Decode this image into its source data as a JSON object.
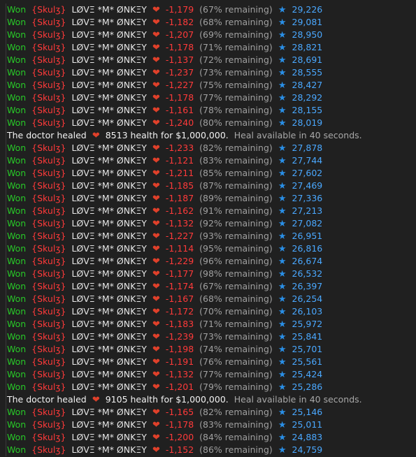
{
  "glyphs": {
    "heart": "❤",
    "star": "★"
  },
  "colors": {
    "background": "#202020",
    "won": "#28c828",
    "red": "#ff3a3a",
    "star": "#2a8fe6",
    "score": "#4aa8ff"
  },
  "lines": [
    {
      "type": "battle",
      "won": "Won",
      "tag": "{Skulʒ}",
      "name": "LØVΞ *M* ØNKΞY",
      "damage": "-1,179",
      "remaining": "(67% remaining)",
      "score": "29,226"
    },
    {
      "type": "battle",
      "won": "Won",
      "tag": "{Skulʒ}",
      "name": "LØVΞ *M* ØNKΞY",
      "damage": "-1,182",
      "remaining": "(68% remaining)",
      "score": "29,081"
    },
    {
      "type": "battle",
      "won": "Won",
      "tag": "{Skulʒ}",
      "name": "LØVΞ *M* ØNKΞY",
      "damage": "-1,207",
      "remaining": "(69% remaining)",
      "score": "28,950"
    },
    {
      "type": "battle",
      "won": "Won",
      "tag": "{Skulʒ}",
      "name": "LØVΞ *M* ØNKΞY",
      "damage": "-1,178",
      "remaining": "(71% remaining)",
      "score": "28,821"
    },
    {
      "type": "battle",
      "won": "Won",
      "tag": "{Skulʒ}",
      "name": "LØVΞ *M* ØNKΞY",
      "damage": "-1,137",
      "remaining": "(72% remaining)",
      "score": "28,691"
    },
    {
      "type": "battle",
      "won": "Won",
      "tag": "{Skulʒ}",
      "name": "LØVΞ *M* ØNKΞY",
      "damage": "-1,237",
      "remaining": "(73% remaining)",
      "score": "28,555"
    },
    {
      "type": "battle",
      "won": "Won",
      "tag": "{Skulʒ}",
      "name": "LØVΞ *M* ØNKΞY",
      "damage": "-1,227",
      "remaining": "(75% remaining)",
      "score": "28,427"
    },
    {
      "type": "battle",
      "won": "Won",
      "tag": "{Skulʒ}",
      "name": "LØVΞ *M* ØNKΞY",
      "damage": "-1,178",
      "remaining": "(77% remaining)",
      "score": "28,292"
    },
    {
      "type": "battle",
      "won": "Won",
      "tag": "{Skulʒ}",
      "name": "LØVΞ *M* ØNKΞY",
      "damage": "-1,161",
      "remaining": "(78% remaining)",
      "score": "28,155"
    },
    {
      "type": "battle",
      "won": "Won",
      "tag": "{Skulʒ}",
      "name": "LØVΞ *M* ØNKΞY",
      "damage": "-1,240",
      "remaining": "(80% remaining)",
      "score": "28,019"
    },
    {
      "type": "doctor",
      "prefix": "The doctor healed",
      "amount": "8513 health for $1,000,000.",
      "note": "Heal available in 40 seconds."
    },
    {
      "type": "battle",
      "won": "Won",
      "tag": "{Skulʒ}",
      "name": "LØVΞ *M* ØNKΞY",
      "damage": "-1,233",
      "remaining": "(82% remaining)",
      "score": "27,878"
    },
    {
      "type": "battle",
      "won": "Won",
      "tag": "{Skulʒ}",
      "name": "LØVΞ *M* ØNKΞY",
      "damage": "-1,121",
      "remaining": "(83% remaining)",
      "score": "27,744"
    },
    {
      "type": "battle",
      "won": "Won",
      "tag": "{Skulʒ}",
      "name": "LØVΞ *M* ØNKΞY",
      "damage": "-1,211",
      "remaining": "(85% remaining)",
      "score": "27,602"
    },
    {
      "type": "battle",
      "won": "Won",
      "tag": "{Skulʒ}",
      "name": "LØVΞ *M* ØNKΞY",
      "damage": "-1,185",
      "remaining": "(87% remaining)",
      "score": "27,469"
    },
    {
      "type": "battle",
      "won": "Won",
      "tag": "{Skulʒ}",
      "name": "LØVΞ *M* ØNKΞY",
      "damage": "-1,187",
      "remaining": "(89% remaining)",
      "score": "27,336"
    },
    {
      "type": "battle",
      "won": "Won",
      "tag": "{Skulʒ}",
      "name": "LØVΞ *M* ØNKΞY",
      "damage": "-1,162",
      "remaining": "(91% remaining)",
      "score": "27,213"
    },
    {
      "type": "battle",
      "won": "Won",
      "tag": "{Skulʒ}",
      "name": "LØVΞ *M* ØNKΞY",
      "damage": "-1,132",
      "remaining": "(92% remaining)",
      "score": "27,082"
    },
    {
      "type": "battle",
      "won": "Won",
      "tag": "{Skulʒ}",
      "name": "LØVΞ *M* ØNKΞY",
      "damage": "-1,227",
      "remaining": "(93% remaining)",
      "score": "26,951"
    },
    {
      "type": "battle",
      "won": "Won",
      "tag": "{Skulʒ}",
      "name": "LØVΞ *M* ØNKΞY",
      "damage": "-1,114",
      "remaining": "(95% remaining)",
      "score": "26,816"
    },
    {
      "type": "battle",
      "won": "Won",
      "tag": "{Skulʒ}",
      "name": "LØVΞ *M* ØNKΞY",
      "damage": "-1,229",
      "remaining": "(96% remaining)",
      "score": "26,674"
    },
    {
      "type": "battle",
      "won": "Won",
      "tag": "{Skulʒ}",
      "name": "LØVΞ *M* ØNKΞY",
      "damage": "-1,177",
      "remaining": "(98% remaining)",
      "score": "26,532"
    },
    {
      "type": "battle",
      "won": "Won",
      "tag": "{Skulʒ}",
      "name": "LØVΞ *M* ØNKΞY",
      "damage": "-1,174",
      "remaining": "(67% remaining)",
      "score": "26,397"
    },
    {
      "type": "battle",
      "won": "Won",
      "tag": "{Skulʒ}",
      "name": "LØVΞ *M* ØNKΞY",
      "damage": "-1,167",
      "remaining": "(68% remaining)",
      "score": "26,254"
    },
    {
      "type": "battle",
      "won": "Won",
      "tag": "{Skulʒ}",
      "name": "LØVΞ *M* ØNKΞY",
      "damage": "-1,172",
      "remaining": "(70% remaining)",
      "score": "26,103"
    },
    {
      "type": "battle",
      "won": "Won",
      "tag": "{Skulʒ}",
      "name": "LØVΞ *M* ØNKΞY",
      "damage": "-1,183",
      "remaining": "(71% remaining)",
      "score": "25,972"
    },
    {
      "type": "battle",
      "won": "Won",
      "tag": "{Skulʒ}",
      "name": "LØVΞ *M* ØNKΞY",
      "damage": "-1,239",
      "remaining": "(73% remaining)",
      "score": "25,841"
    },
    {
      "type": "battle",
      "won": "Won",
      "tag": "{Skulʒ}",
      "name": "LØVΞ *M* ØNKΞY",
      "damage": "-1,198",
      "remaining": "(74% remaining)",
      "score": "25,701"
    },
    {
      "type": "battle",
      "won": "Won",
      "tag": "{Skulʒ}",
      "name": "LØVΞ *M* ØNKΞY",
      "damage": "-1,191",
      "remaining": "(76% remaining)",
      "score": "25,561"
    },
    {
      "type": "battle",
      "won": "Won",
      "tag": "{Skulʒ}",
      "name": "LØVΞ *M* ØNKΞY",
      "damage": "-1,132",
      "remaining": "(77% remaining)",
      "score": "25,424"
    },
    {
      "type": "battle",
      "won": "Won",
      "tag": "{Skulʒ}",
      "name": "LØVΞ *M* ØNKΞY",
      "damage": "-1,201",
      "remaining": "(79% remaining)",
      "score": "25,286"
    },
    {
      "type": "doctor",
      "prefix": "The doctor healed",
      "amount": "9105 health for $1,000,000.",
      "note": "Heal available in 40 seconds."
    },
    {
      "type": "battle",
      "won": "Won",
      "tag": "{Skulʒ}",
      "name": "LØVΞ *M* ØNKΞY",
      "damage": "-1,165",
      "remaining": "(82% remaining)",
      "score": "25,146"
    },
    {
      "type": "battle",
      "won": "Won",
      "tag": "{Skulʒ}",
      "name": "LØVΞ *M* ØNKΞY",
      "damage": "-1,178",
      "remaining": "(83% remaining)",
      "score": "25,011"
    },
    {
      "type": "battle",
      "won": "Won",
      "tag": "{Skulʒ}",
      "name": "LØVΞ *M* ØNKΞY",
      "damage": "-1,200",
      "remaining": "(84% remaining)",
      "score": "24,883"
    },
    {
      "type": "battle",
      "won": "Won",
      "tag": "{Skulʒ}",
      "name": "LØVΞ *M* ØNKΞY",
      "damage": "-1,152",
      "remaining": "(86% remaining)",
      "score": "24,759"
    }
  ]
}
